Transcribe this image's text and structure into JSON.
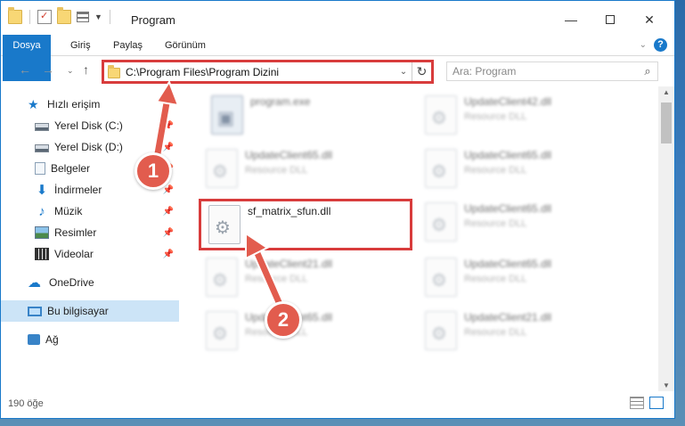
{
  "window": {
    "title": "Program",
    "controls": {
      "minimize": "—",
      "maximize": "",
      "close": "✕"
    }
  },
  "ribbon": {
    "tabs": [
      "Dosya",
      "Giriş",
      "Paylaş",
      "Görünüm"
    ]
  },
  "nav": {
    "address": "C:\\Program Files\\Program Dizini",
    "search_placeholder": "Ara: Program"
  },
  "sidebar": {
    "items": [
      {
        "label": "Hızlı erişim",
        "icon": "star-icon"
      },
      {
        "label": "Yerel Disk (C:)",
        "icon": "disk-icon",
        "pinned": true
      },
      {
        "label": "Yerel Disk (D:)",
        "icon": "disk-icon",
        "pinned": true
      },
      {
        "label": "Belgeler",
        "icon": "document-icon",
        "pinned": true
      },
      {
        "label": "İndirmeler",
        "icon": "download-icon",
        "pinned": true
      },
      {
        "label": "Müzik",
        "icon": "music-icon",
        "pinned": true
      },
      {
        "label": "Resimler",
        "icon": "pictures-icon",
        "pinned": true
      },
      {
        "label": "Videolar",
        "icon": "video-icon",
        "pinned": true
      },
      {
        "label": "OneDrive",
        "icon": "cloud-icon"
      },
      {
        "label": "Bu bilgisayar",
        "icon": "computer-icon",
        "selected": true
      },
      {
        "label": "Ağ",
        "icon": "network-icon"
      }
    ]
  },
  "files": [
    {
      "name": "program.exe",
      "type": ""
    },
    {
      "name": "UpdateClient42.dll",
      "type": "Resource DLL"
    },
    {
      "name": "UpdateClient65.dll",
      "type": "Resource DLL"
    },
    {
      "name": "UpdateClient65.dll",
      "type": "Resource DLL"
    },
    {
      "name": "sf_matrix_sfun.dll",
      "type": ""
    },
    {
      "name": "UpdateClient65.dll",
      "type": "Resource DLL"
    },
    {
      "name": "UpdateClient21.dll",
      "type": "Resource DLL"
    },
    {
      "name": "UpdateClient65.dll",
      "type": "Resource DLL"
    },
    {
      "name": "UpdateClient65.dll",
      "type": "Resource DLL"
    },
    {
      "name": "UpdateClient21.dll",
      "type": "Resource DLL"
    }
  ],
  "status": {
    "count": "190 öğe"
  },
  "annotations": {
    "step1": "1",
    "step2": "2"
  },
  "colors": {
    "accent": "#1979ca",
    "highlight": "#d83c3c",
    "badge": "#e25c4e"
  }
}
